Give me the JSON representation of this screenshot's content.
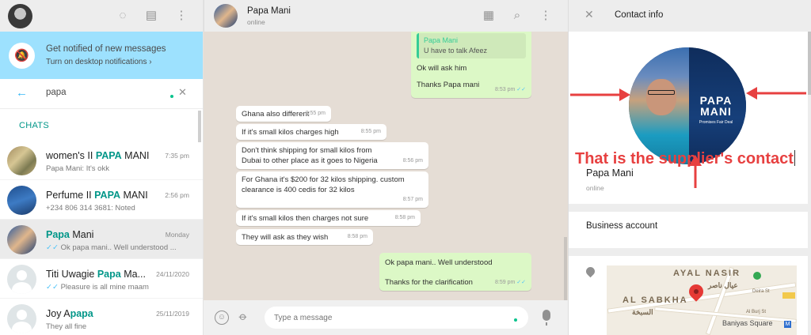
{
  "left": {
    "notification": {
      "title": "Get notified of new messages",
      "subtitle": "Turn on desktop notifications ›"
    },
    "search": {
      "query": "papa"
    },
    "chats_label": "CHATS",
    "chats": [
      {
        "pre": "women's II ",
        "hl": "PAPA",
        "post": " MANI",
        "time": "7:35 pm",
        "last": "Papa Mani: It's okk"
      },
      {
        "pre": "Perfume II ",
        "hl": "PAPA",
        "post": " MANI",
        "time": "2:56 pm",
        "last": "+234 806 314 3681: Noted"
      },
      {
        "pre": "",
        "hl": "Papa",
        "post": " Mani",
        "time": "Monday",
        "last": "Ok papa mani.. Well understood ..."
      },
      {
        "pre": "Titi Uwagie ",
        "hl": "Papa",
        "post": " Ma...",
        "time": "24/11/2020",
        "last": "Pleasure is all mine maam"
      },
      {
        "pre": "Joy A",
        "hl": "papa",
        "post": "",
        "time": "25/11/2019",
        "last": "They all fine"
      }
    ]
  },
  "conversation": {
    "name": "Papa Mani",
    "status": "online",
    "quote_name": "Papa Mani",
    "quote_text": "U have to talk Afeez",
    "out1_a": "Ok will ask him",
    "out1_b": "Thanks Papa mani",
    "out1_time": "8:53 pm",
    "in": [
      {
        "text": "Ghana also different",
        "time": "8:55 pm"
      },
      {
        "text": "If it's small kilos charges high",
        "time": "8:55 pm"
      },
      {
        "text": "Don't think shipping for small kilos from Dubai to other place as it goes to Nigeria",
        "time": "8:56 pm"
      },
      {
        "text": "For Ghana it's $200 for 32 kilos shipping. custom clearance is 400 cedis for 32 kilos",
        "time": "8:57 pm"
      },
      {
        "text": "If it's small kilos then charges not sure",
        "time": "8:58 pm"
      },
      {
        "text": "They will ask as they wish",
        "time": "8:58 pm"
      }
    ],
    "out2_a": "Ok papa mani.. Well understood",
    "out2_b": "Thanks for the clarification",
    "out2_time": "8:59 pm",
    "compose_placeholder": "Type a message"
  },
  "contact": {
    "title": "Contact info",
    "name": "Papa Mani",
    "about": "online",
    "poster_name": "PAPA MANI",
    "poster_tag": "Promises Fair Deal",
    "annotation": "That is the supplier's contact",
    "business": "Business account",
    "map_labels": {
      "area": "AYAL NASIR",
      "area_ar": "عيال ناصر",
      "sabkha": "AL SABKHA",
      "sabkha_ar": "السبخة",
      "square": "Baniyas Square",
      "road": "Deira St",
      "burj": "Al Burj St"
    }
  },
  "colors": {
    "accent": "#009688",
    "annotation": "#e74040",
    "notify": "#9de1fe"
  }
}
